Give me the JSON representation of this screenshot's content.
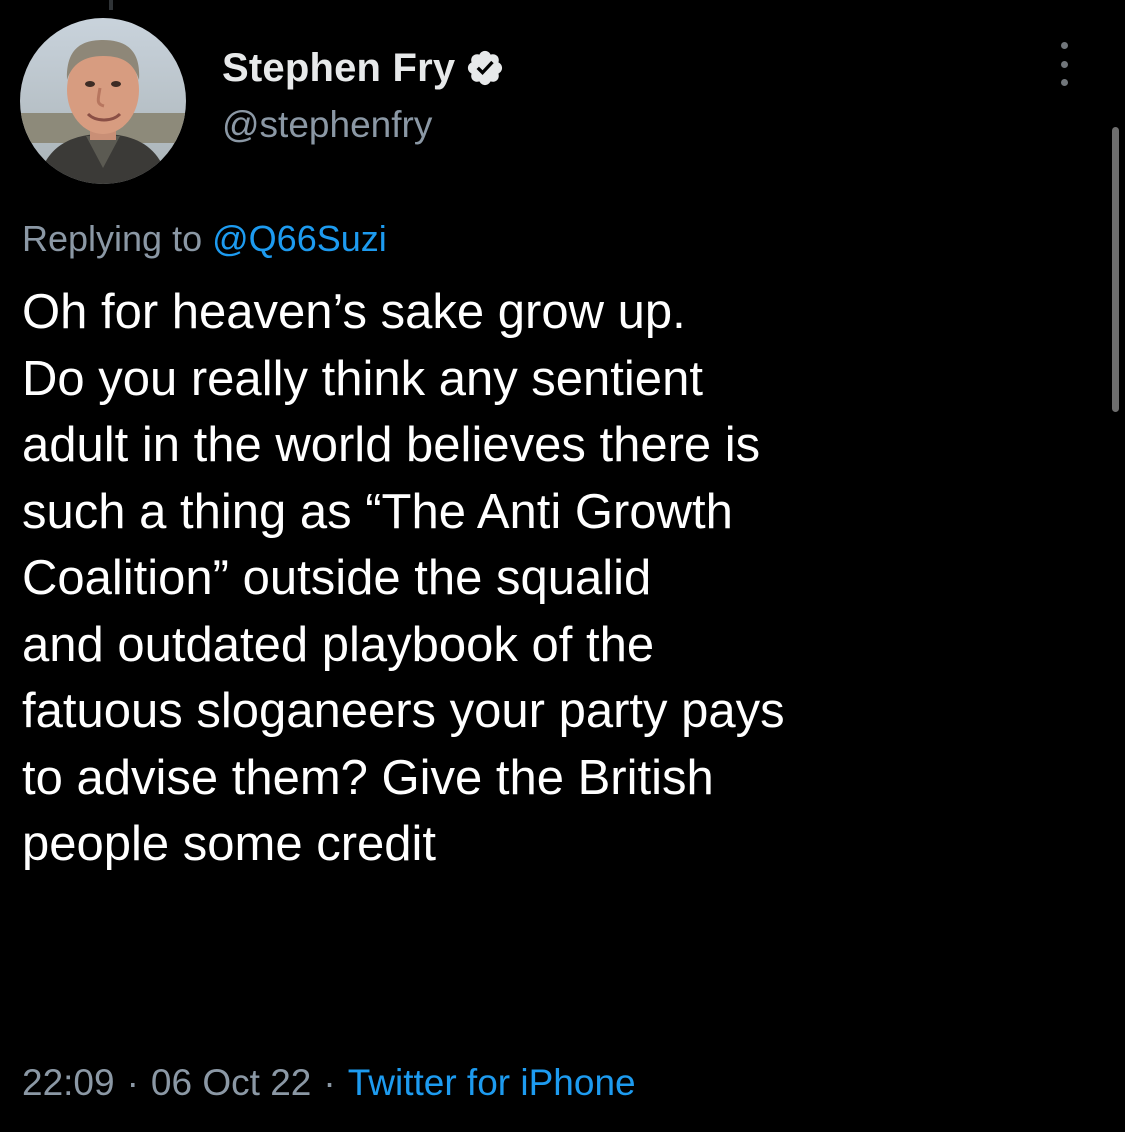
{
  "tweet": {
    "author": {
      "display_name": "Stephen Fry",
      "handle": "@stephenfry",
      "verified": true,
      "avatar_icon": "profile-photo"
    },
    "replying_to": {
      "label": "Replying to",
      "mention": "@Q66Suzi"
    },
    "text_lines": [
      "Oh for heaven’s sake grow up.",
      "Do you really think any sentient",
      "adult in the world believes there is",
      "such a thing as “The Anti Growth",
      "Coalition” outside the squalid",
      "and outdated playbook of the",
      "fatuous sloganeers your party pays",
      "to advise them? Give the British",
      "people some credit"
    ],
    "time": "22:09",
    "date": "06 Oct 22",
    "separator": "·",
    "source": "Twitter for iPhone"
  },
  "colors": {
    "background": "#000000",
    "text": "#ffffff",
    "secondary": "#8b98a5",
    "accent": "#1d9bf0"
  }
}
